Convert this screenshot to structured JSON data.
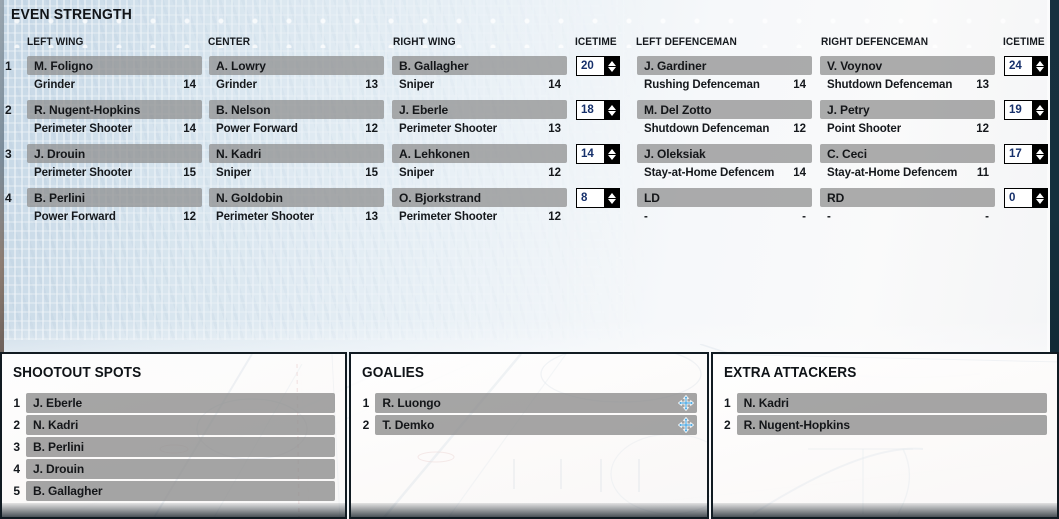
{
  "even_strength": {
    "title": "EVEN STRENGTH",
    "headers": {
      "left_wing": "LEFT WING",
      "center": "CENTER",
      "right_wing": "RIGHT WING",
      "icetime_forwards": "ICETIME",
      "left_defenceman": "LEFT DEFENCEMAN",
      "right_defenceman": "RIGHT DEFENCEMAN",
      "icetime_defence": "ICETIME"
    },
    "lines": [
      {
        "number": "1",
        "left_wing": {
          "name": "M. Foligno",
          "type": "Grinder",
          "rating": "14"
        },
        "center": {
          "name": "A. Lowry",
          "type": "Grinder",
          "rating": "13"
        },
        "right_wing": {
          "name": "B. Gallagher",
          "type": "Sniper",
          "rating": "14"
        },
        "icetime_forwards": "20",
        "left_defenceman": {
          "name": "J. Gardiner",
          "type": "Rushing Defenceman",
          "rating": "14"
        },
        "right_defenceman": {
          "name": "V. Voynov",
          "type": "Shutdown Defenceman",
          "rating": "13"
        },
        "icetime_defence": "24"
      },
      {
        "number": "2",
        "left_wing": {
          "name": "R. Nugent-Hopkins",
          "type": "Perimeter Shooter",
          "rating": "14"
        },
        "center": {
          "name": "B. Nelson",
          "type": "Power Forward",
          "rating": "12"
        },
        "right_wing": {
          "name": "J. Eberle",
          "type": "Perimeter Shooter",
          "rating": "13"
        },
        "icetime_forwards": "18",
        "left_defenceman": {
          "name": "M. Del Zotto",
          "type": "Shutdown Defenceman",
          "rating": "12"
        },
        "right_defenceman": {
          "name": "J. Petry",
          "type": "Point Shooter",
          "rating": "12"
        },
        "icetime_defence": "19"
      },
      {
        "number": "3",
        "left_wing": {
          "name": "J. Drouin",
          "type": "Perimeter Shooter",
          "rating": "15"
        },
        "center": {
          "name": "N. Kadri",
          "type": "Sniper",
          "rating": "15"
        },
        "right_wing": {
          "name": "A. Lehkonen",
          "type": "Sniper",
          "rating": "12"
        },
        "icetime_forwards": "14",
        "left_defenceman": {
          "name": "J. Oleksiak",
          "type": "Stay-at-Home Defencem",
          "rating": "14"
        },
        "right_defenceman": {
          "name": "C. Ceci",
          "type": "Stay-at-Home Defencem",
          "rating": "11"
        },
        "icetime_defence": "17"
      },
      {
        "number": "4",
        "left_wing": {
          "name": "B. Perlini",
          "type": "Power Forward",
          "rating": "12"
        },
        "center": {
          "name": "N. Goldobin",
          "type": "Perimeter Shooter",
          "rating": "13"
        },
        "right_wing": {
          "name": "O. Bjorkstrand",
          "type": "Perimeter Shooter",
          "rating": "12"
        },
        "icetime_forwards": "8",
        "left_defenceman": {
          "name": "LD",
          "type": "-",
          "rating": "-"
        },
        "right_defenceman": {
          "name": "RD",
          "type": "-",
          "rating": "-"
        },
        "icetime_defence": "0"
      }
    ]
  },
  "shootout_spots": {
    "title": "SHOOTOUT SPOTS",
    "items": [
      {
        "number": "1",
        "name": "J. Eberle"
      },
      {
        "number": "2",
        "name": "N. Kadri"
      },
      {
        "number": "3",
        "name": "B. Perlini"
      },
      {
        "number": "4",
        "name": "J. Drouin"
      },
      {
        "number": "5",
        "name": "B. Gallagher"
      }
    ]
  },
  "goalies": {
    "title": "GOALIES",
    "items": [
      {
        "number": "1",
        "name": "R. Luongo",
        "icon": "move-icon"
      },
      {
        "number": "2",
        "name": "T. Demko",
        "icon": "move-icon"
      }
    ]
  },
  "extra_attackers": {
    "title": "EXTRA ATTACKERS",
    "items": [
      {
        "number": "1",
        "name": "N. Kadri"
      },
      {
        "number": "2",
        "name": "R. Nugent-Hopkins"
      }
    ]
  },
  "colors": {
    "slot_bar": "#8c8c8c",
    "spinner_text": "#16306b",
    "panel_border": "#111b22",
    "move_icon": "#4aa6e0"
  }
}
